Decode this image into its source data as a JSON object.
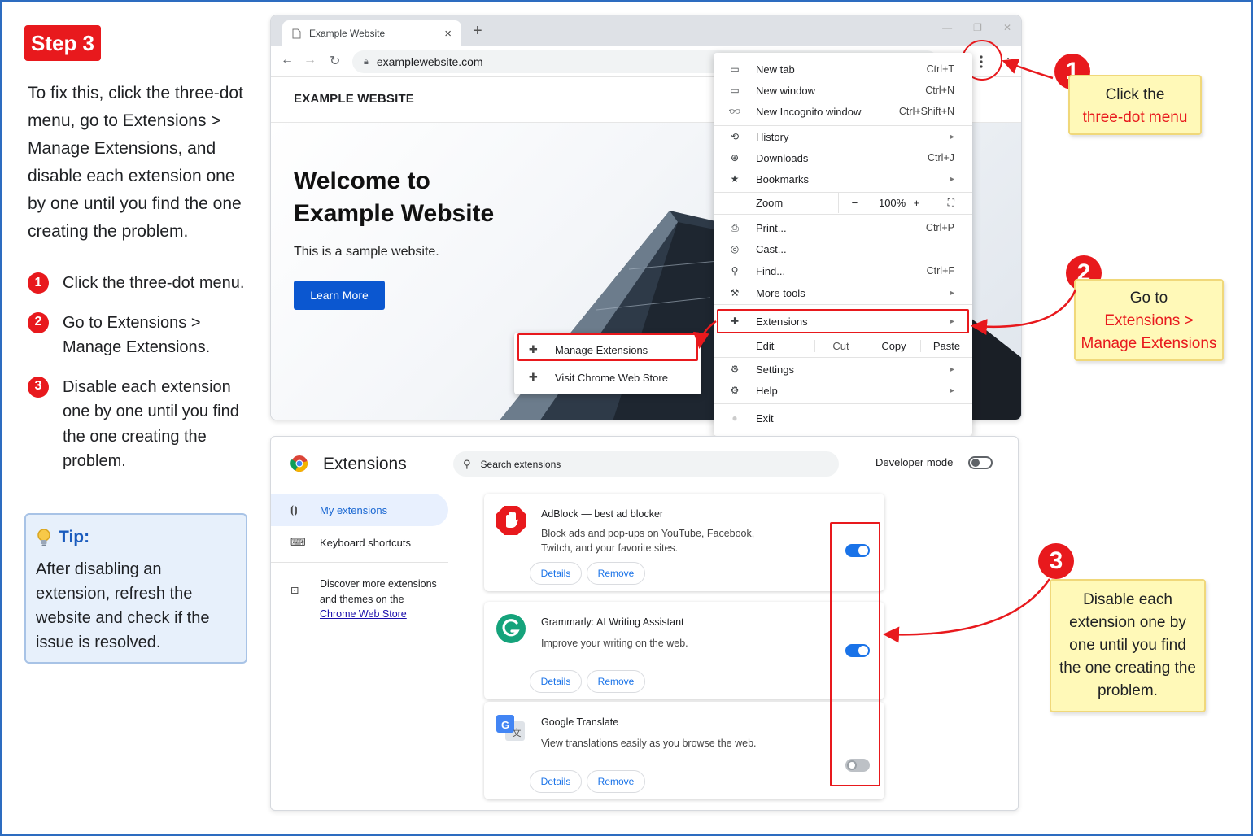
{
  "step_label": "Step 3",
  "intro": "To fix this, click the three-dot menu, go to Extensions > Manage Extensions, and disable each extension one by one until you find the one creating the problem.",
  "steps": [
    {
      "num": "1",
      "text": "Click the three-dot menu."
    },
    {
      "num": "2",
      "text": "Go to Extensions > Manage Extensions."
    },
    {
      "num": "3",
      "text": "Disable each extension one by one until you find the one creating the problem."
    }
  ],
  "tip": {
    "title": "Tip:",
    "text": "After disabling an extension, refresh the website and check if the issue is resolved."
  },
  "browser": {
    "tab_title": "Example Website",
    "tab_close": "×",
    "new_tab": "+",
    "url": "examplewebsite.com",
    "site_brand": "EXAMPLE WEBSITE",
    "hero_title": "Welcome to Example Website",
    "hero_text": "This is a sample website.",
    "learn_more": "Learn More"
  },
  "menu": {
    "new_tab": {
      "label": "New tab",
      "shortcut": "Ctrl+T"
    },
    "new_window": {
      "label": "New window",
      "shortcut": "Ctrl+N"
    },
    "incognito": {
      "label": "New Incognito window",
      "shortcut": "Ctrl+Shift+N"
    },
    "history": {
      "label": "History"
    },
    "downloads": {
      "label": "Downloads",
      "shortcut": "Ctrl+J"
    },
    "bookmarks": {
      "label": "Bookmarks"
    },
    "zoom": {
      "label": "Zoom",
      "minus": "−",
      "value": "100%",
      "plus": "+"
    },
    "print": {
      "label": "Print...",
      "shortcut": "Ctrl+P"
    },
    "cast": {
      "label": "Cast..."
    },
    "find": {
      "label": "Find...",
      "shortcut": "Ctrl+F"
    },
    "more_tools": {
      "label": "More tools"
    },
    "extensions": {
      "label": "Extensions"
    },
    "edit": {
      "label": "Edit",
      "cut": "Cut",
      "copy": "Copy",
      "paste": "Paste"
    },
    "settings": {
      "label": "Settings"
    },
    "help": {
      "label": "Help"
    },
    "exit": {
      "label": "Exit"
    }
  },
  "submenu": {
    "manage": "Manage Extensions",
    "store": "Visit Chrome Web Store"
  },
  "callouts": {
    "c1": {
      "num": "1",
      "line1": "Click the",
      "line2": "three-dot menu"
    },
    "c2": {
      "num": "2",
      "line1": "Go to",
      "line2": "Extensions >",
      "line3": "Manage Extensions"
    },
    "c3": {
      "num": "3",
      "text": "Disable each extension one by one until you find the one creating the problem."
    }
  },
  "extensions_page": {
    "title": "Extensions",
    "search_placeholder": "Search extensions",
    "developer_mode": "Developer mode",
    "developer_mode_on": false,
    "sidebar": {
      "my_extensions": "My extensions",
      "shortcuts": "Keyboard shortcuts",
      "discover": "Discover more extensions and themes on the",
      "store_link": "Chrome Web Store"
    },
    "cards": [
      {
        "name": "AdBlock — best ad blocker",
        "desc": "Block ads and pop-ups on YouTube, Facebook, Twitch, and your favorite sites.",
        "details": "Details",
        "remove": "Remove",
        "enabled": true
      },
      {
        "name": "Grammarly: AI Writing Assistant",
        "desc": "Improve your writing on the web.",
        "details": "Details",
        "remove": "Remove",
        "enabled": true
      },
      {
        "name": "Google Translate",
        "desc": "View translations easily as you browse the web.",
        "details": "Details",
        "remove": "Remove",
        "enabled": false
      }
    ]
  },
  "colors": {
    "accent_red": "#e8191d",
    "toggle_blue": "#1a73e8",
    "callout_yellow": "#fff9b8",
    "tip_blue": "#1a5bbd"
  }
}
